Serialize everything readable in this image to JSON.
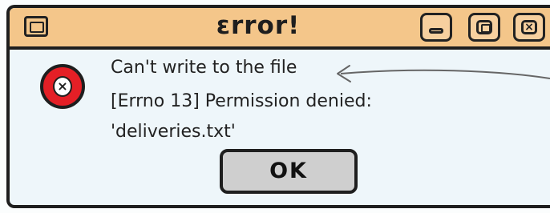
{
  "window": {
    "title": "εrror!"
  },
  "message": {
    "line1": "Can't write to the file",
    "line2": "[Errno 13] Permission denied:",
    "line3": "'deliveries.txt'"
  },
  "buttons": {
    "ok_label": "OK",
    "close_glyph": "×"
  },
  "icons": {
    "app": "window-icon",
    "error": "error-x-icon",
    "minimize": "minimize-icon",
    "maximize": "maximize-icon",
    "close": "close-icon"
  },
  "colors": {
    "titlebar": "#f4c68a",
    "window_body": "#eef6fa",
    "error_icon": "#e41f26",
    "ok_button": "#cfcfcf"
  }
}
